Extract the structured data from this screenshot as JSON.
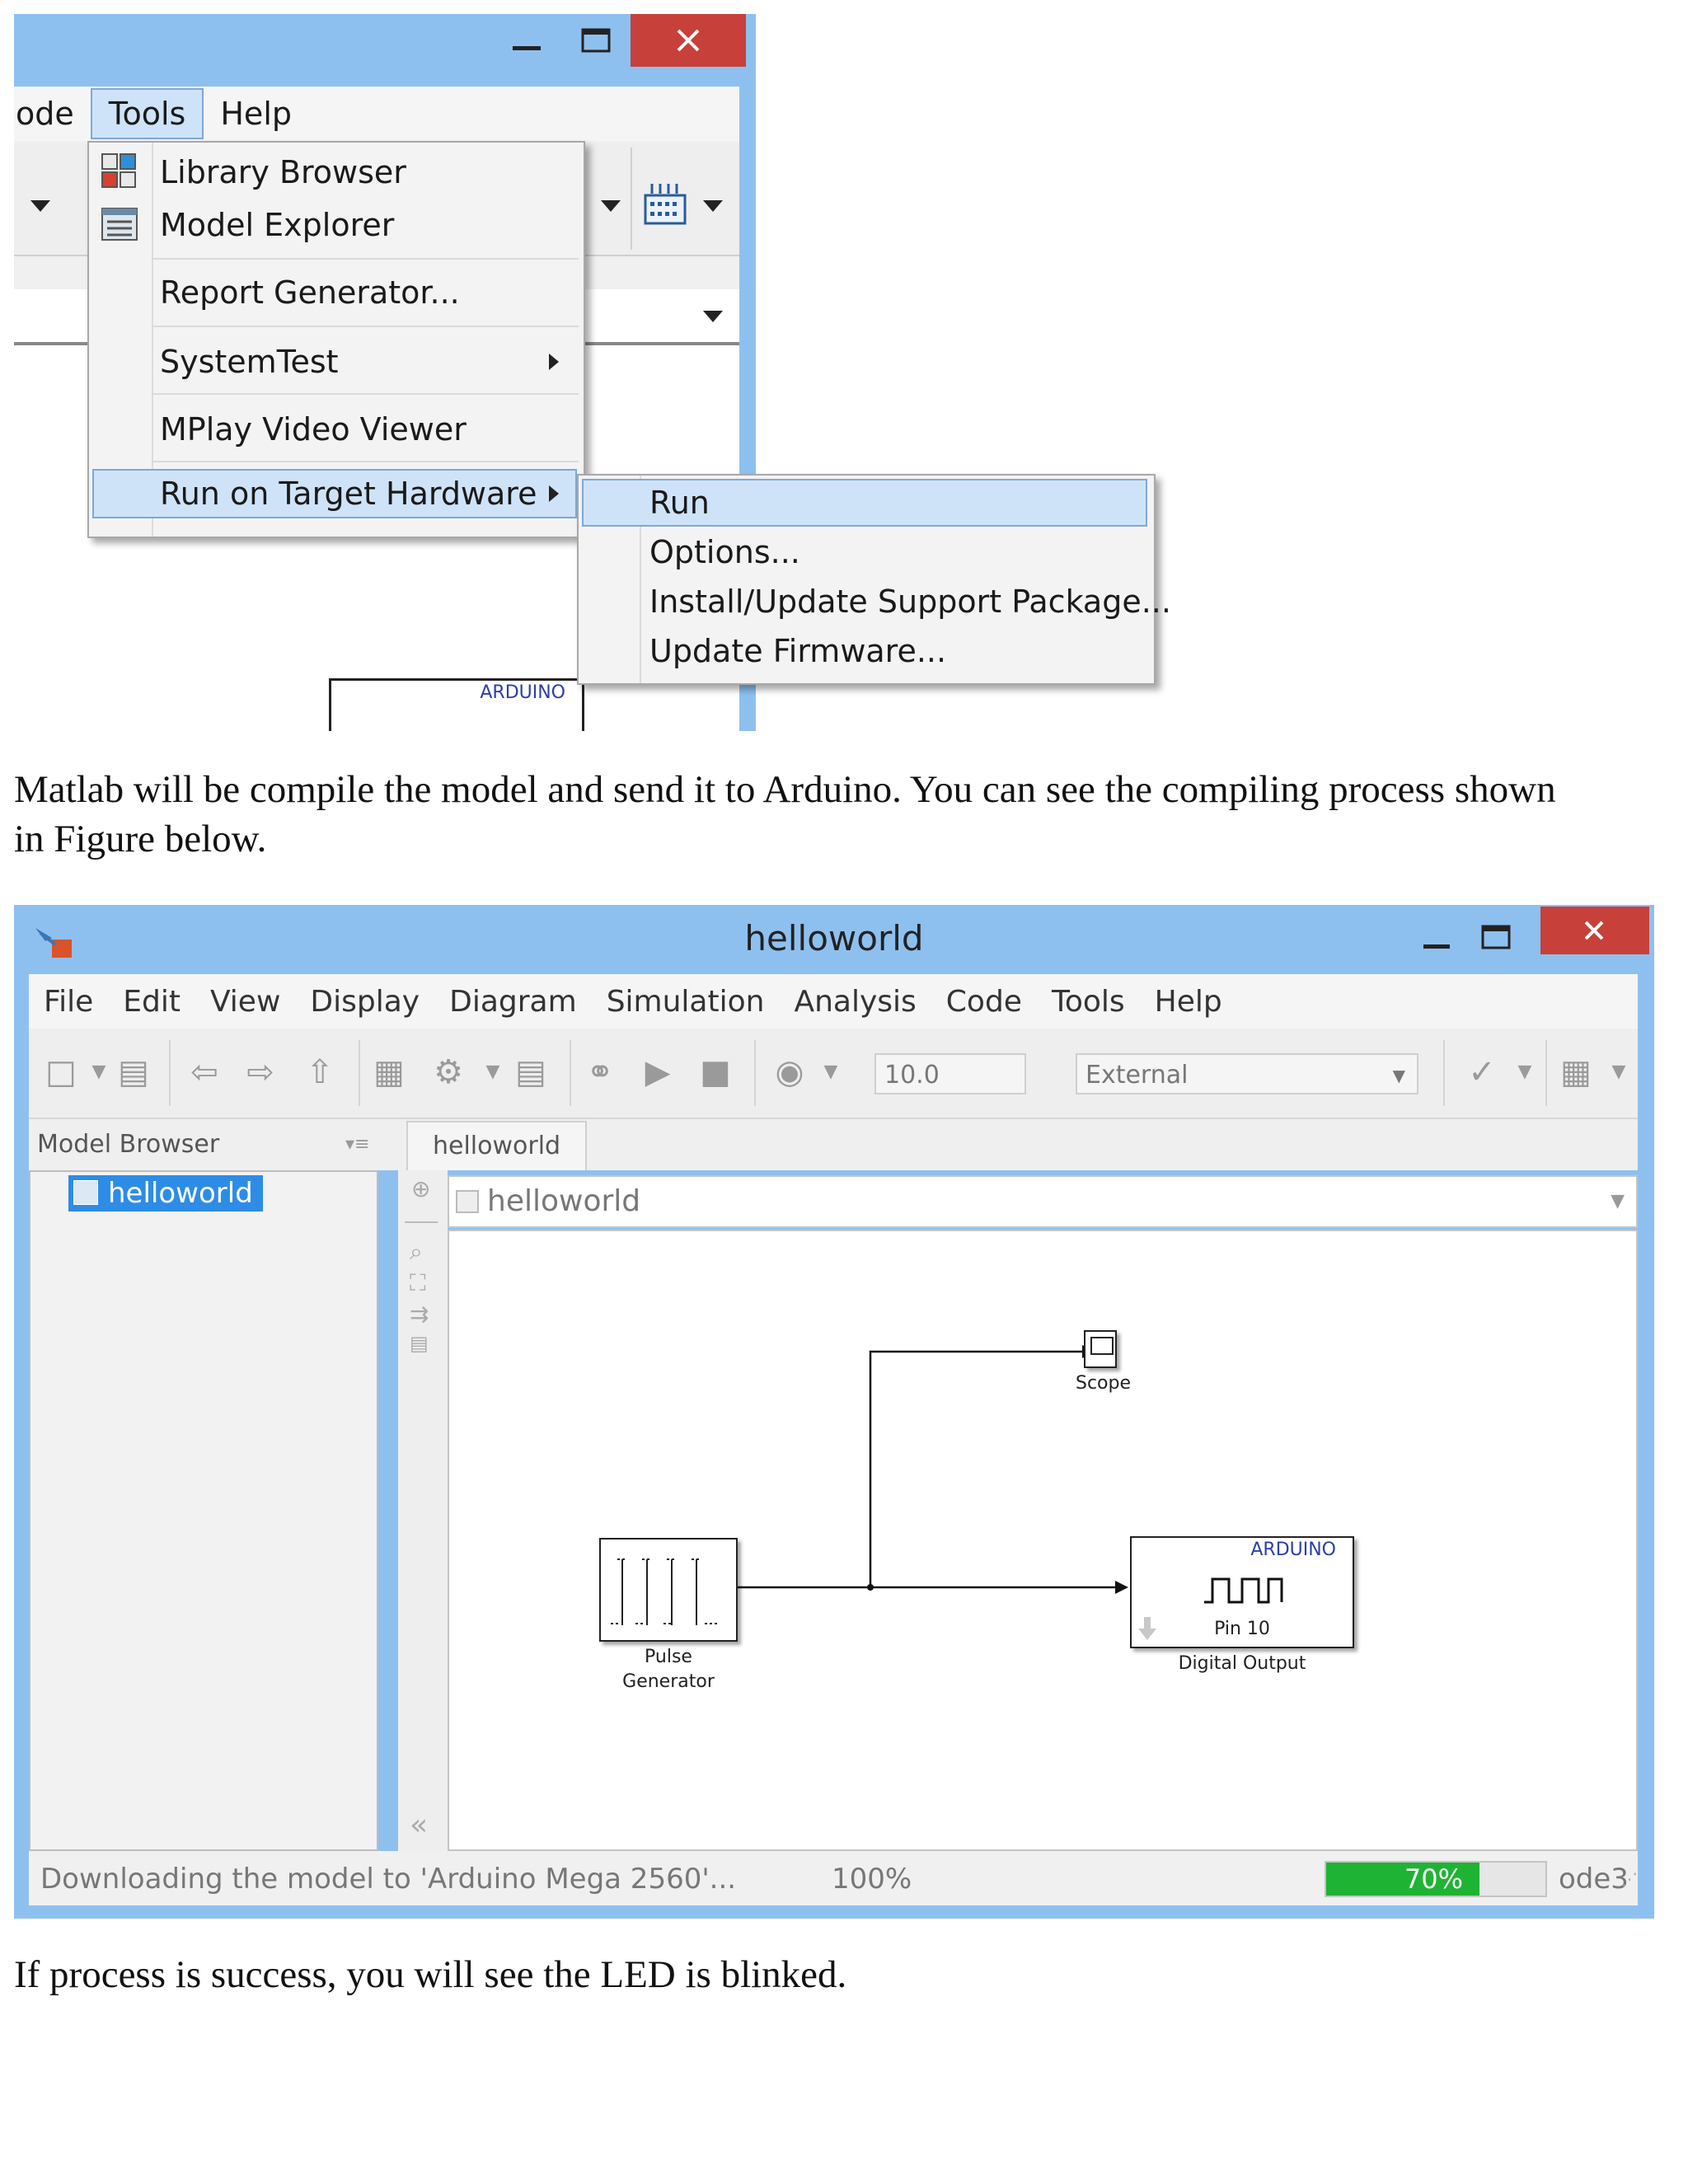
{
  "top_window": {
    "menu": [
      "ode",
      "Tools",
      "Help"
    ],
    "active_menu": "Tools",
    "tools_menu": {
      "items": [
        "Library Browser",
        "Model Explorer",
        "Report Generator...",
        "SystemTest",
        "MPlay Video Viewer",
        "Run on Target Hardware"
      ],
      "submenu_items": [
        "Run",
        "Options...",
        "Install/Update Support Package...",
        "Update Firmware..."
      ]
    },
    "block_label": "ARDUINO"
  },
  "paragraph1": {
    "line1": "Matlab will be compile the model and send it to Arduino. You can see the compiling process shown",
    "line2": "in Figure below."
  },
  "model_window": {
    "title": "helloworld",
    "menu": [
      "File",
      "Edit",
      "View",
      "Display",
      "Diagram",
      "Simulation",
      "Analysis",
      "Code",
      "Tools",
      "Help"
    ],
    "stop_time": "10.0",
    "mode": "External",
    "model_browser_label": "Model Browser",
    "tree_item": "helloworld",
    "tab_label": "helloworld",
    "address": "helloworld",
    "blocks": {
      "scope": "Scope",
      "pulse_line1": "Pulse",
      "pulse_line2": "Generator",
      "arduino_tag": "ARDUINO",
      "pin": "Pin 10",
      "digital_output": "Digital Output"
    },
    "status": {
      "message": "Downloading the model to 'Arduino Mega 2560'...",
      "zoom": "100%",
      "progress_label": "70%",
      "progress": 0.7,
      "solver": "ode3"
    }
  },
  "paragraph2": "If process is success, you will see the LED is blinked."
}
